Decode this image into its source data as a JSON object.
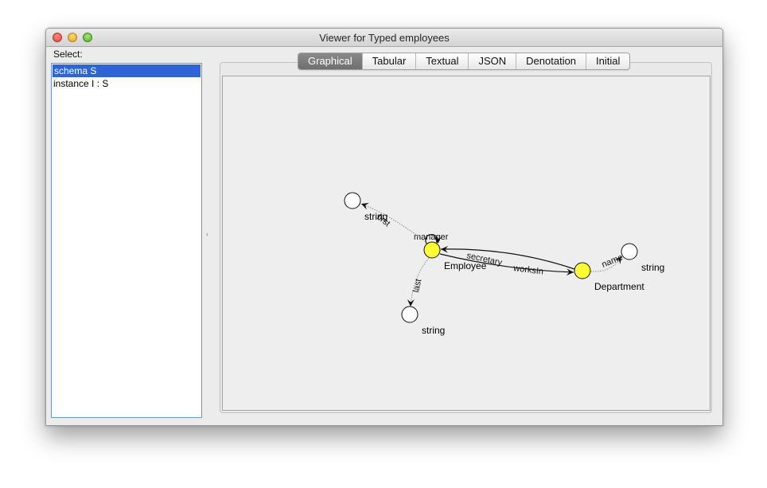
{
  "window": {
    "title": "Viewer for Typed employees"
  },
  "sidebar": {
    "label": "Select:",
    "items": [
      {
        "label": "schema S",
        "selected": true
      },
      {
        "label": "instance I : S",
        "selected": false
      }
    ]
  },
  "tabs": [
    {
      "label": "Graphical",
      "active": true
    },
    {
      "label": "Tabular",
      "active": false
    },
    {
      "label": "Textual",
      "active": false
    },
    {
      "label": "JSON",
      "active": false
    },
    {
      "label": "Denotation",
      "active": false
    },
    {
      "label": "Initial",
      "active": false
    }
  ],
  "graph": {
    "nodes": [
      {
        "id": "employee",
        "label": "Employee",
        "kind": "entity",
        "color": "#ffff33"
      },
      {
        "id": "department",
        "label": "Department",
        "kind": "entity",
        "color": "#ffff33"
      },
      {
        "id": "string_first",
        "label": "string",
        "kind": "type",
        "color": "#ffffff"
      },
      {
        "id": "string_last",
        "label": "string",
        "kind": "type",
        "color": "#ffffff"
      },
      {
        "id": "string_name",
        "label": "string",
        "kind": "type",
        "color": "#ffffff"
      }
    ],
    "edges": [
      {
        "label": "manager",
        "from": "employee",
        "to": "employee",
        "style": "solid"
      },
      {
        "label": "secretary",
        "from": "department",
        "to": "employee",
        "style": "solid"
      },
      {
        "label": "worksIn",
        "from": "employee",
        "to": "department",
        "style": "solid"
      },
      {
        "label": "first",
        "from": "employee",
        "to": "string_first",
        "style": "dotted"
      },
      {
        "label": "last",
        "from": "employee",
        "to": "string_last",
        "style": "dotted"
      },
      {
        "label": "name",
        "from": "department",
        "to": "string_name",
        "style": "dotted"
      }
    ]
  }
}
